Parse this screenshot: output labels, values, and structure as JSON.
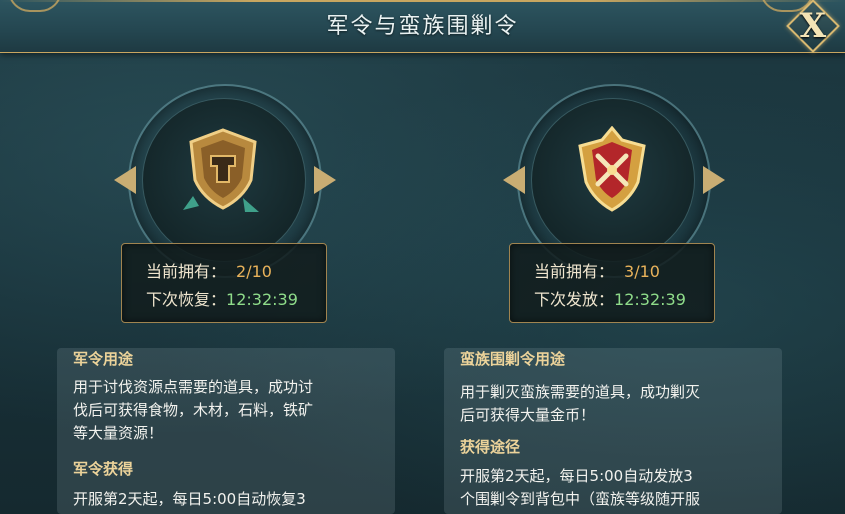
{
  "header": {
    "title": "军令与蛮族围剿令",
    "close_label": "X"
  },
  "left": {
    "item_icon": "shield-token-icon",
    "stats": {
      "own_label": "当前拥有：",
      "own_value": "2/10",
      "next_label": "下次恢复：",
      "next_value": "12:32:39"
    },
    "usage_title": "军令用途",
    "usage_text": [
      "用于讨伐资源点需要的道具，成功讨",
      "伐后可获得食物，木材，石料，铁矿",
      "等大量资源！"
    ],
    "obtain_title": "军令获得",
    "obtain_text": [
      "开服第2天起，每日5:00自动恢复3"
    ]
  },
  "right": {
    "item_icon": "red-gold-badge-icon",
    "stats": {
      "own_label": "当前拥有：",
      "own_value": "3/10",
      "next_label": "下次发放：",
      "next_value": "12:32:39"
    },
    "usage_title": "蛮族围剿令用途",
    "usage_text": [
      "用于剿灭蛮族需要的道具，成功剿灭",
      "后可获得大量金币！"
    ],
    "obtain_title": "获得途径",
    "obtain_text": [
      "开服第2天起，每日5:00自动发放3",
      "个围剿令到背包中（蛮族等级随开服"
    ]
  },
  "colors": {
    "accent_gold": "#c8a660",
    "value_amber": "#e8b25a",
    "timer_green": "#8fdc8a"
  }
}
